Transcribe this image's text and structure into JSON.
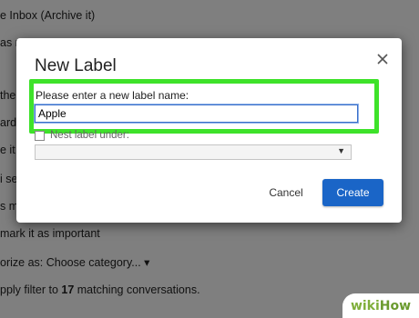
{
  "background": {
    "lines": [
      {
        "pre": "e Inbox (Archive it)",
        "bold": "",
        "post": ""
      },
      {
        "pre": "as r",
        "bold": "",
        "post": ""
      },
      {
        "pre": "",
        "bold": "",
        "post": ""
      },
      {
        "pre": "the",
        "bold": "",
        "post": ""
      },
      {
        "pre": "ard i",
        "bold": "",
        "post": ""
      },
      {
        "pre": "e it",
        "bold": "",
        "post": ""
      },
      {
        "pre": "i se",
        "bold": "",
        "post": ""
      },
      {
        "pre": "s m",
        "bold": "",
        "post": ""
      },
      {
        "pre": "",
        "bold": "",
        "post": ""
      },
      {
        "pre": "mark it as important",
        "bold": "",
        "post": ""
      },
      {
        "pre": "orize as:  Choose category...  ▾",
        "bold": "",
        "post": ""
      },
      {
        "pre": "pply filter to ",
        "bold": "17",
        "post": " matching conversations."
      }
    ]
  },
  "dialog": {
    "title": "New Label",
    "prompt": "Please enter a new label name:",
    "input_value": "Apple",
    "nest_label": "Nest label under:",
    "parent_select_value": "",
    "cancel_label": "Cancel",
    "create_label": "Create"
  },
  "icons": {
    "close": "close-icon",
    "dropdown": "dropdown-arrow-icon"
  },
  "colors": {
    "highlight": "#3ee22a",
    "create_button": "#1a65c7",
    "overlay": "rgba(0,0,0,0.50)"
  },
  "watermark": {
    "wiki": "wiki",
    "how": "How"
  }
}
